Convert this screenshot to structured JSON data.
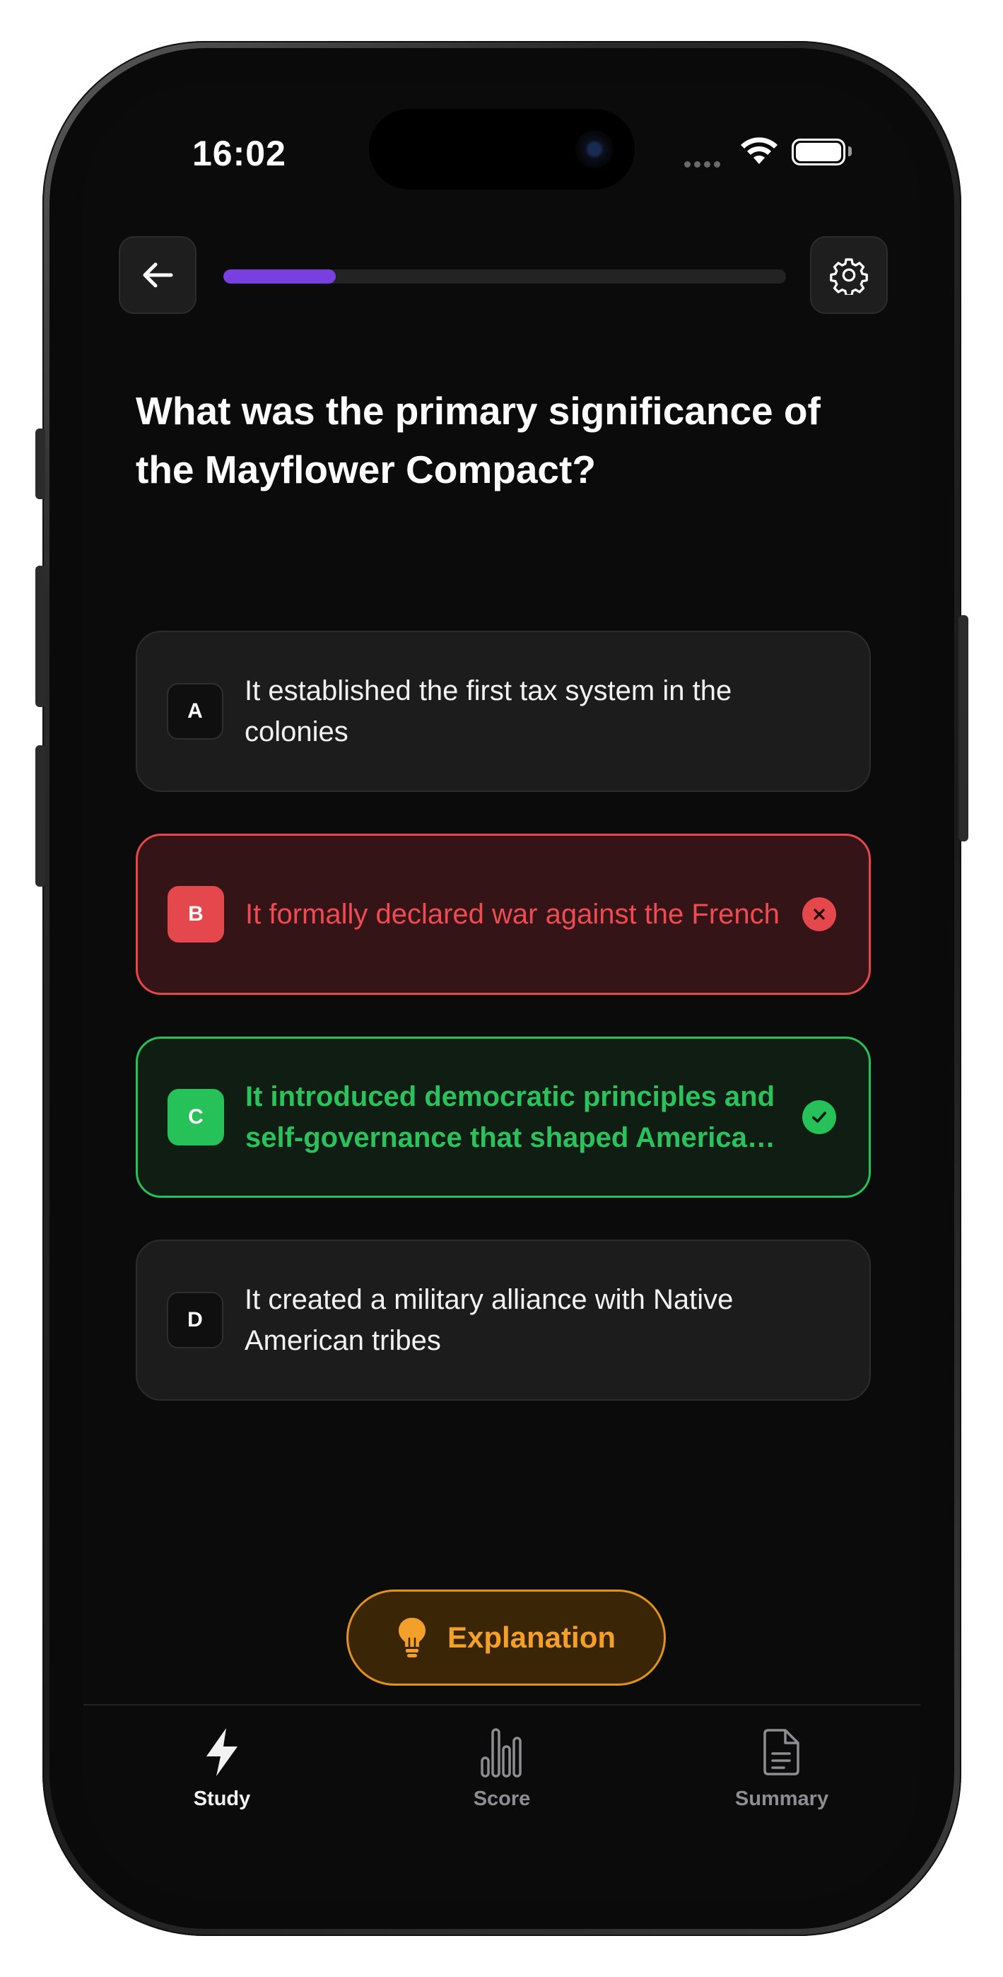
{
  "status_bar": {
    "time": "16:02"
  },
  "top_bar": {
    "progress_fraction": 0.2,
    "progress_color": "#7a3fe0"
  },
  "question": {
    "text": "What was the primary significance of the Mayflower Compact?"
  },
  "options": [
    {
      "letter": "A",
      "text": "It established the first tax system in the colonies",
      "state": "neutral"
    },
    {
      "letter": "B",
      "text": "It formally declared war against the French",
      "state": "wrong"
    },
    {
      "letter": "C",
      "text": "It introduced democratic principles and self-governance that shaped American democracy",
      "state": "correct"
    },
    {
      "letter": "D",
      "text": "It created a military alliance with Native American tribes",
      "state": "neutral"
    }
  ],
  "explanation_button": {
    "label": "Explanation",
    "icon": "lightbulb-icon"
  },
  "tabs": [
    {
      "label": "Study",
      "icon": "lightning-icon",
      "active": true
    },
    {
      "label": "Score",
      "icon": "bar-chart-icon",
      "active": false
    },
    {
      "label": "Summary",
      "icon": "document-icon",
      "active": false
    }
  ],
  "colors": {
    "wrong": "#e4474c",
    "correct": "#27c15a",
    "explanation": "#e0921a",
    "accent": "#7a3fe0"
  }
}
